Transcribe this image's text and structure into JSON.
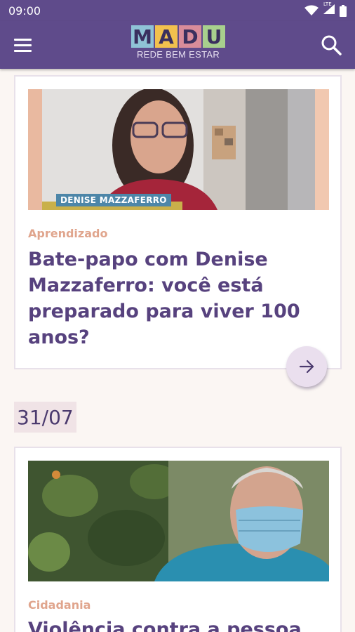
{
  "status_bar": {
    "time": "09:00",
    "network": "LTE"
  },
  "app_bar": {
    "logo_letters": [
      "M",
      "A",
      "D",
      "U"
    ],
    "logo_colors": [
      "#8fc3d6",
      "#f2c14e",
      "#d88c9a",
      "#a8d08d"
    ],
    "tagline": "REDE BEM ESTAR",
    "menu_icon": "hamburger-icon",
    "search_icon": "search-icon"
  },
  "feed": {
    "article1": {
      "video_caption": "DENISE MAZZAFERRO",
      "category": "Aprendizado",
      "title": "Bate-papo com Denise Mazzaferro: você está preparado para viver 100 anos?",
      "action_icon": "arrow-right-icon"
    },
    "date_label": "31/07",
    "article2": {
      "category": "Cidadania",
      "title": "Violência contra a pessoa"
    }
  },
  "colors": {
    "brand_purple": "#5f4b8b",
    "category": "#e0a58d",
    "title": "#57427e",
    "background": "#fbf6f3"
  }
}
